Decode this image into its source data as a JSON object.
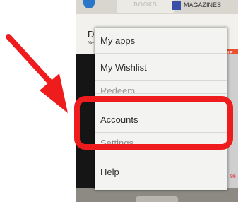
{
  "store_tabs": {
    "books": "BOOKS",
    "magazines": "MAGAZINES"
  },
  "background": {
    "title": "D",
    "subtitle": "Ne",
    "badge": "RE",
    "price": "99"
  },
  "menu": {
    "items": [
      {
        "label": "My apps",
        "visible": true
      },
      {
        "label": "My Wishlist",
        "visible": true
      },
      {
        "label": "Redeem",
        "visible": false
      },
      {
        "label": "Accounts",
        "visible": true
      },
      {
        "label": "Settings",
        "visible": false
      },
      {
        "label": "Help",
        "visible": true
      }
    ]
  },
  "annotations": {
    "highlight_color": "#ee1c1c",
    "arrow_color": "#ee1c1c",
    "highlighted_item": "Accounts"
  }
}
